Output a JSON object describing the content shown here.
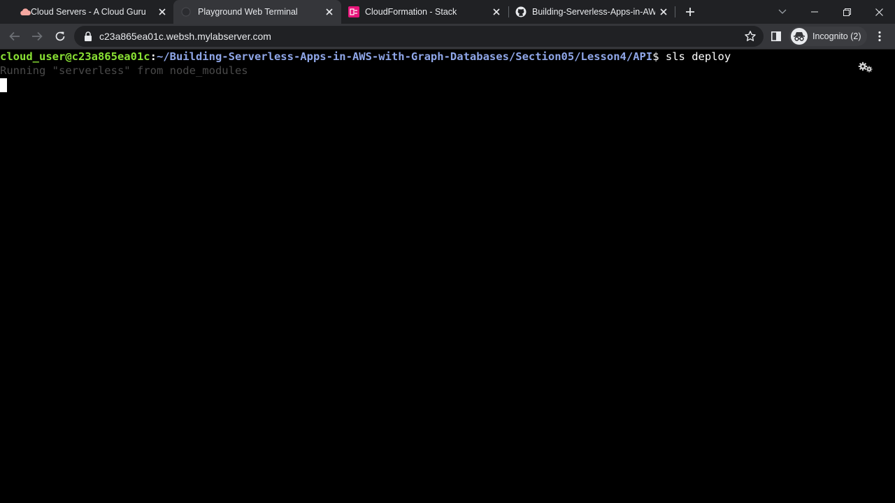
{
  "tabs": [
    {
      "title": "Cloud Servers - A Cloud Guru",
      "icon": "cloud-icon",
      "active": false
    },
    {
      "title": "Playground Web Terminal",
      "icon": "terminal-globe-icon",
      "active": true
    },
    {
      "title": "CloudFormation - Stack",
      "icon": "cloudformation-icon",
      "active": false
    },
    {
      "title": "Building-Serverless-Apps-in-AWS",
      "icon": "github-icon",
      "active": false
    }
  ],
  "toolbar": {
    "url": "c23a865ea01c.websh.mylabserver.com",
    "incognito_label": "Incognito (2)"
  },
  "terminal": {
    "prompt_user": "cloud_user@c23a865ea01c",
    "prompt_colon": ":",
    "prompt_path": "~/Building-Serverless-Apps-in-AWS-with-Graph-Databases/Section05/Lesson4/API",
    "prompt_cmd": "$ sls deploy",
    "output_line": "Running \"serverless\" from node_modules"
  },
  "colors": {
    "tabstrip": "#202124",
    "toolbar": "#35363a",
    "terminal_bg": "#000000",
    "prompt_user": "#8ae234",
    "prompt_path": "#8fa6e8",
    "dim_text": "#4a4a4a"
  }
}
